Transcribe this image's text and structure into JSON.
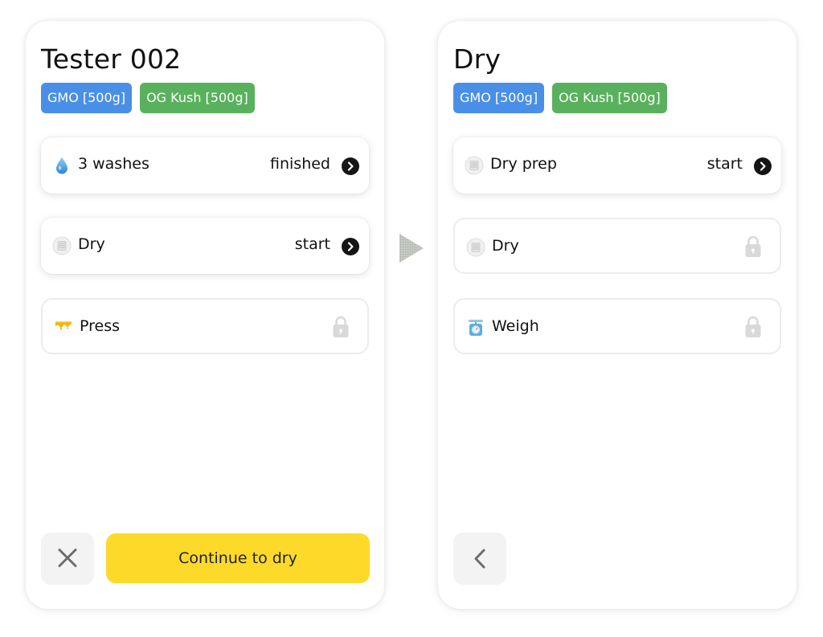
{
  "left_panel": {
    "title": "Tester 002",
    "tags": [
      "GMO [500g]",
      "OG Kush [500g]"
    ],
    "steps": [
      {
        "label": "3 washes",
        "status": "finished",
        "icon": "water-drop-icon",
        "state": "active"
      },
      {
        "label": "Dry",
        "status": "start",
        "icon": "dry-rack-icon",
        "state": "active"
      },
      {
        "label": "Press",
        "status": "",
        "icon": "press-icon",
        "state": "locked"
      }
    ],
    "cancel_icon": "close-icon",
    "continue_label": "Continue to dry"
  },
  "right_panel": {
    "title": "Dry",
    "tags": [
      "GMO [500g]",
      "OG Kush [500g]"
    ],
    "steps": [
      {
        "label": "Dry prep",
        "status": "start",
        "icon": "dry-rack-icon",
        "state": "active"
      },
      {
        "label": "Dry",
        "status": "",
        "icon": "dry-rack-icon",
        "state": "locked"
      },
      {
        "label": "Weigh",
        "status": "",
        "icon": "scale-icon",
        "state": "locked"
      }
    ],
    "back_icon": "chevron-left-icon"
  },
  "colors": {
    "tag_blue": "#4a8fe7",
    "tag_green": "#59b15d",
    "primary_button": "#fdda29",
    "lock_gray": "#d9d9d9"
  }
}
